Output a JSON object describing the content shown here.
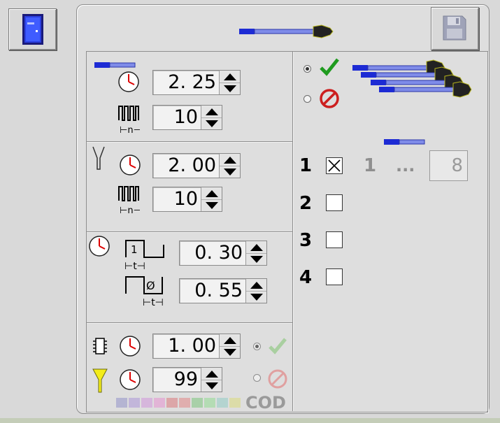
{
  "timing_group_1": {
    "time_value": "2. 25",
    "count_value": "10"
  },
  "timing_group_2": {
    "time_value": "2. 00",
    "count_value": "10"
  },
  "timing_group_3": {
    "t1_label": "1",
    "t1_value": "0. 30",
    "t2_label": "Ø",
    "t2_value": "0. 55"
  },
  "timing_group_4": {
    "time_value": "1. 00",
    "count_value": "99",
    "cod_label": "COD"
  },
  "channels": [
    {
      "label": "1",
      "checked": true
    },
    {
      "label": "2",
      "checked": false
    },
    {
      "label": "3",
      "checked": false
    },
    {
      "label": "4",
      "checked": false
    }
  ],
  "range": {
    "from": "1",
    "dots": "...",
    "to": "8"
  },
  "colors": {
    "swatches": [
      "#b4b4d2",
      "#c2b6da",
      "#d6b6dc",
      "#e2b4d6",
      "#dca6a8",
      "#e0aeae",
      "#a8d0a8",
      "#b4dcb4",
      "#b4d4d0",
      "#dcdca8"
    ]
  },
  "icons": {
    "exit": "door-icon",
    "save": "floppy-disk-icon",
    "ok": "checkmark-icon",
    "cancel": "prohibited-icon",
    "clock": "clock-icon",
    "pulse": "pulse-train-icon",
    "probe": "probe-icon",
    "chip": "chip-icon",
    "funnel": "funnel-icon"
  }
}
